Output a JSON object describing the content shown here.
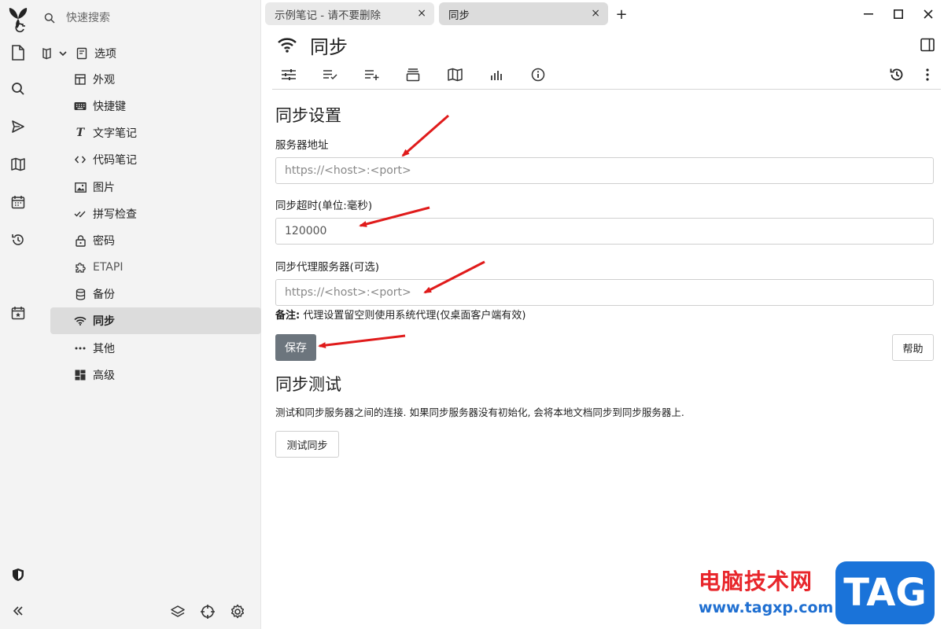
{
  "search": {
    "placeholder": "快速搜索"
  },
  "tree": {
    "root_label": "选项",
    "items": [
      {
        "label": "外观",
        "icon": "layout-icon"
      },
      {
        "label": "快捷键",
        "icon": "keyboard-icon"
      },
      {
        "label": "文字笔记",
        "icon": "text-icon"
      },
      {
        "label": "代码笔记",
        "icon": "code-icon"
      },
      {
        "label": "图片",
        "icon": "image-icon"
      },
      {
        "label": "拼写检查",
        "icon": "check-icon"
      },
      {
        "label": "密码",
        "icon": "lock-icon"
      },
      {
        "label": "ETAPI",
        "icon": "puzzle-icon"
      },
      {
        "label": "备份",
        "icon": "database-icon"
      },
      {
        "label": "同步",
        "icon": "wifi-icon",
        "active": true
      },
      {
        "label": "其他",
        "icon": "dots-icon"
      },
      {
        "label": "高级",
        "icon": "dashboard-icon"
      }
    ]
  },
  "tabs": [
    {
      "label": "示例笔记 - 请不要删除",
      "active": false
    },
    {
      "label": "同步",
      "active": true
    }
  ],
  "note": {
    "title": "同步"
  },
  "sync_settings": {
    "heading": "同步设置",
    "server_label": "服务器地址",
    "server_placeholder": "https://<host>:<port>",
    "timeout_label": "同步超时(单位:毫秒)",
    "timeout_value": "120000",
    "proxy_label": "同步代理服务器(可选)",
    "proxy_placeholder": "https://<host>:<port>",
    "note_bold": "备注:",
    "note_text": " 代理设置留空则使用系统代理(仅桌面客户端有效)",
    "save_label": "保存",
    "help_label": "帮助"
  },
  "sync_test": {
    "heading": "同步测试",
    "description": "测试和同步服务器之间的连接. 如果同步服务器没有初始化, 会将本地文档同步到同步服务器上.",
    "button_label": "测试同步"
  },
  "watermark": {
    "text": "电脑技术网",
    "url": "www.tagxp.com",
    "badge": "TAG"
  },
  "colors": {
    "sidebar_bg": "#f3f3f3",
    "active_item_bg": "#dcdcdc",
    "save_button": "#6c757d",
    "annotation_arrow": "#e01b1b",
    "watermark_red": "#e8262b",
    "watermark_blue": "#1a73d9"
  }
}
